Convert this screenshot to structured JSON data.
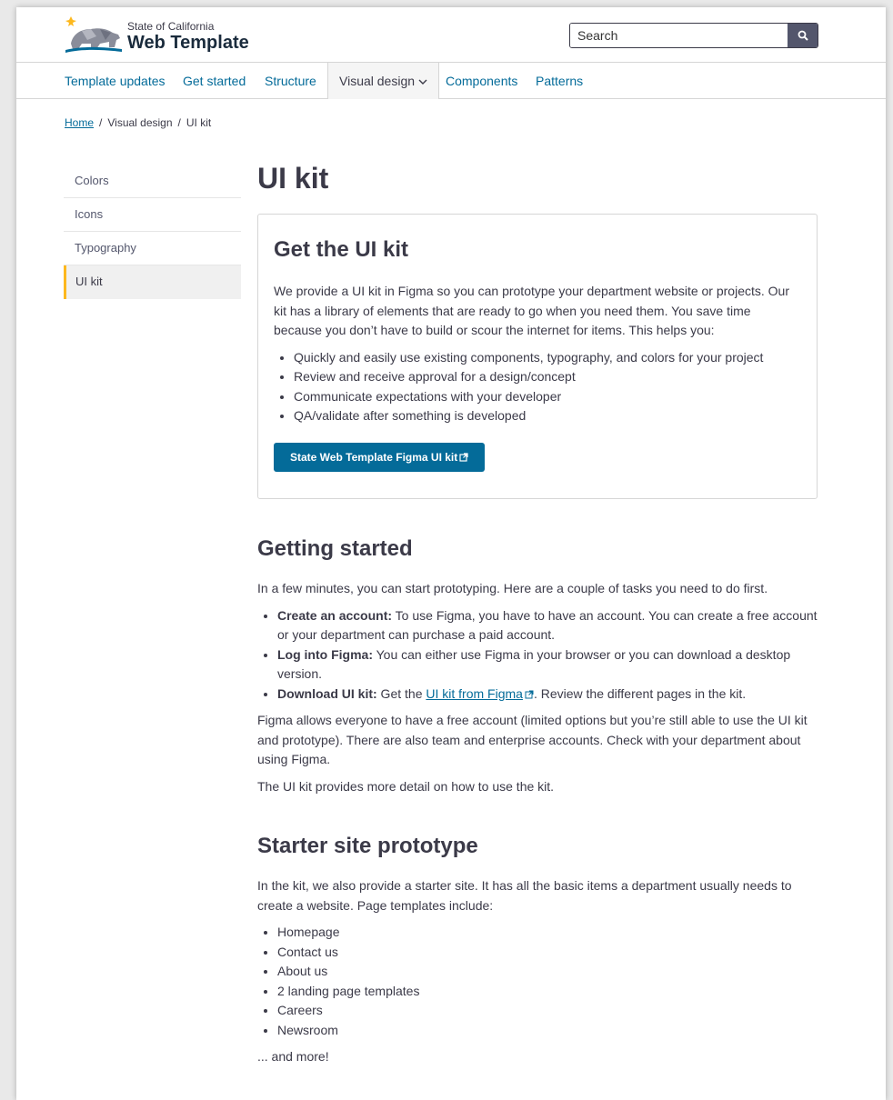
{
  "header": {
    "brand_small": "State of California",
    "brand_big": "Web Template",
    "search_placeholder": "Search"
  },
  "nav": {
    "items": [
      "Template updates",
      "Get started",
      "Structure",
      "Visual design",
      "Components",
      "Patterns"
    ],
    "active": "Visual design"
  },
  "breadcrumb": {
    "home": "Home",
    "section": "Visual design",
    "current": "UI kit",
    "separator": "/"
  },
  "sidenav": {
    "items": [
      "Colors",
      "Icons",
      "Typography",
      "UI kit"
    ],
    "active": "UI kit"
  },
  "main": {
    "title": "UI kit",
    "card": {
      "heading": "Get the UI kit",
      "intro": "We provide a UI kit in Figma so you can prototype your department website or projects. Our kit has a library of elements that are ready to go when you need them. You save time because you don’t have to build or scour the internet for items. This helps you:",
      "bullets": [
        "Quickly and easily use existing components, typography, and colors for your project",
        "Review and receive approval for a design/concept",
        "Communicate expectations with your developer",
        "QA/validate after something is developed"
      ],
      "button": "State Web Template Figma UI kit"
    },
    "getting_started": {
      "heading": "Getting started",
      "intro": "In a few minutes, you can start prototyping. Here are a couple of tasks you need to do first.",
      "tasks": [
        {
          "label": "Create an account:",
          "text": " To use Figma, you have to have an account. You can create a free account or your department can purchase a paid account."
        },
        {
          "label": "Log into Figma:",
          "text": " You can either use Figma in your browser or you can download a desktop version."
        }
      ],
      "download": {
        "label": "Download UI kit:",
        "pre": " Get the ",
        "link": "UI kit from Figma",
        "post": ". Review the different pages in the kit."
      },
      "para1": "Figma allows everyone to have a free account (limited options but you’re still able to use the UI kit and prototype). There are also team and enterprise accounts. Check with your department about using Figma.",
      "para2": "The UI kit provides more detail on how to use the kit."
    },
    "starter": {
      "heading": "Starter site prototype",
      "intro": "In the kit, we also provide a starter site. It has all the basic items a department usually needs to create a website. Page templates include:",
      "pages": [
        "Homepage",
        "Contact us",
        "About us",
        "2 landing page templates",
        "Careers",
        "Newsroom"
      ],
      "outro": "... and more!"
    }
  },
  "colors": {
    "link": "#046b99",
    "accent": "#fdb81e",
    "text": "#3b3a48",
    "search_button": "#53566c"
  }
}
